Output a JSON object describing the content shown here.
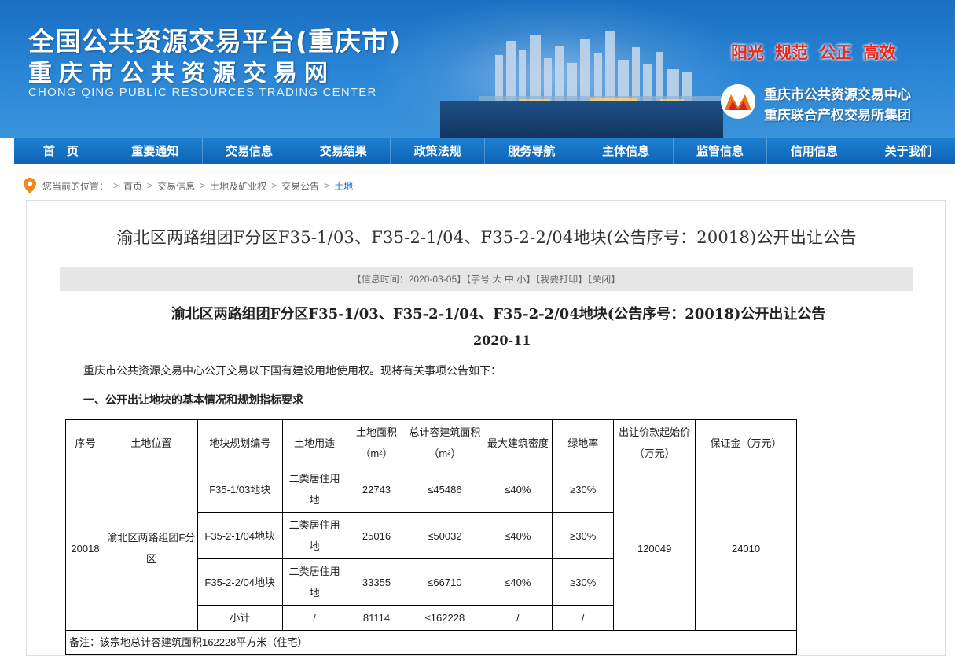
{
  "header": {
    "title_line1": "全国公共资源交易平台(重庆市)",
    "title_line2": "重庆市公共资源交易网",
    "title_en": "CHONG QING PUBLIC RESOURCES TRADING CENTER",
    "slogans": [
      "阳光",
      "规范",
      "公正",
      "高效"
    ],
    "org_line1": "重庆市公共资源交易中心",
    "org_line2": "重庆联合产权交易所集团"
  },
  "nav": {
    "items": [
      "首　页",
      "重要通知",
      "交易信息",
      "交易结果",
      "政策法规",
      "服务导航",
      "主体信息",
      "监管信息",
      "信用信息",
      "关于我们"
    ]
  },
  "breadcrumb": {
    "prefix": "您当前的位置：",
    "items": [
      "首页",
      "交易信息",
      "土地及矿业权",
      "交易公告"
    ],
    "current": "土地"
  },
  "article": {
    "title": "渝北区两路组团F分区F35-1/03、F35-2-1/04、F35-2-2/04地块(公告序号：20018)公开出让公告",
    "info": {
      "time_label": "【信息时间：",
      "time": "2020-03-05",
      "time_close": "】",
      "font_label": "【字号 ",
      "font_large": "大",
      "font_medium": "中",
      "font_small": "小",
      "font_close": "】",
      "print": "【我要打印】",
      "close": "【关闭】"
    },
    "sub_title": "渝北区两路组团F分区F35-1/03、F35-2-1/04、F35-2-2/04地块(公告序号：20018)公开出让公告",
    "sub_date": "2020-11",
    "intro": "重庆市公共资源交易中心公开交易以下国有建设用地使用权。现将有关事项公告如下：",
    "section_1": "一、公开出让地块的基本情况和规划指标要求"
  },
  "table": {
    "headers": [
      "序号",
      "土地位置",
      "地块规划编号",
      "土地用途",
      "土地面积（m²）",
      "总计容建筑面积（m²）",
      "最大建筑密度",
      "绿地率",
      "出让价款起始价（万元）",
      "保证金（万元）"
    ],
    "serial": "20018",
    "location": "渝北区两路组团F分区",
    "rows": [
      {
        "code": "F35-1/03地块",
        "use": "二类居住用地",
        "area": "22743",
        "gfa": "≤45486",
        "density": "≤40%",
        "green": "≥30%"
      },
      {
        "code": "F35-2-1/04地块",
        "use": "二类居住用地",
        "area": "25016",
        "gfa": "≤50032",
        "density": "≤40%",
        "green": "≥30%"
      },
      {
        "code": "F35-2-2/04地块",
        "use": "二类居住用地",
        "area": "33355",
        "gfa": "≤66710",
        "density": "≤40%",
        "green": "≥30%"
      }
    ],
    "subtotal": {
      "label": "小计",
      "use": "/",
      "area": "81114",
      "gfa": "≤162228",
      "density": "/",
      "green": "/"
    },
    "start_price": "120049",
    "deposit": "24010",
    "note": "备注：该宗地总计容建筑面积162228平方米（住宅）"
  },
  "colors": {
    "nav_bg": "#0d63b4",
    "slogan": "#e9281f",
    "breadcrumb_current": "#1a77c9"
  }
}
